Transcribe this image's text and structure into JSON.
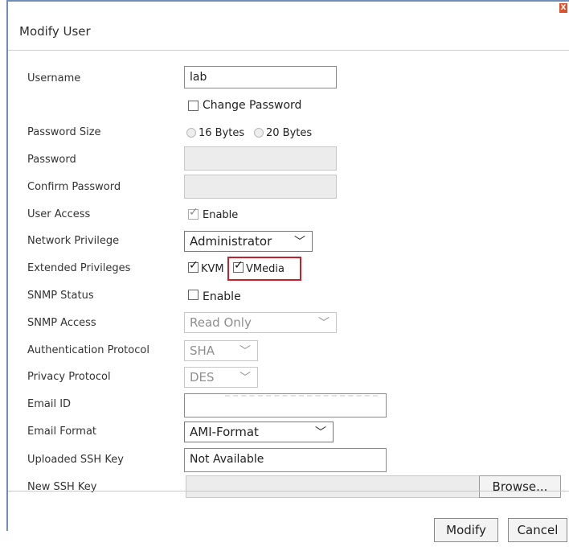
{
  "dialog": {
    "title": "Modify User",
    "close_glyph": "X"
  },
  "labels": {
    "username": "Username",
    "password_size": "Password Size",
    "password": "Password",
    "confirm_password": "Confirm Password",
    "user_access": "User Access",
    "network_privilege": "Network Privilege",
    "extended_privileges": "Extended Privileges",
    "snmp_status": "SNMP Status",
    "snmp_access": "SNMP Access",
    "auth_protocol": "Authentication Protocol",
    "privacy_protocol": "Privacy Protocol",
    "email_id": "Email ID",
    "email_format": "Email Format",
    "uploaded_ssh_key": "Uploaded SSH Key",
    "new_ssh_key": "New SSH Key"
  },
  "fields": {
    "username_value": "lab",
    "change_password_label": "Change Password",
    "change_password_checked": false,
    "password_size_16": "16 Bytes",
    "password_size_20": "20 Bytes",
    "password_value": "",
    "confirm_password_value": "",
    "user_access_label": "Enable",
    "user_access_checked": true,
    "network_privilege_value": "Administrator",
    "kvm_label": "KVM",
    "kvm_checked": true,
    "vmedia_label": "VMedia",
    "vmedia_checked": true,
    "snmp_status_label": "Enable",
    "snmp_status_checked": false,
    "snmp_access_value": "Read Only",
    "auth_protocol_value": "SHA",
    "privacy_protocol_value": "DES",
    "email_id_value": "",
    "email_format_value": "AMI-Format",
    "uploaded_ssh_key_value": "Not Available",
    "new_ssh_key_value": "",
    "browse_label": "Browse..."
  },
  "buttons": {
    "modify": "Modify",
    "cancel": "Cancel"
  },
  "colors": {
    "highlight": "#c8202a",
    "close_button": "#d9532c",
    "frame_accent": "#6f8fb8"
  }
}
